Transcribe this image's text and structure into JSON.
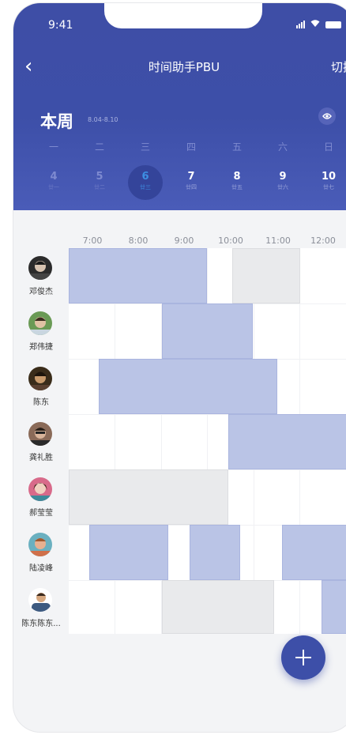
{
  "status": {
    "time": "9:41"
  },
  "header": {
    "back_label": "‹",
    "title": "时间助手PBU",
    "switch_label": "切换"
  },
  "week": {
    "title": "本周",
    "range": "8.04-8.10",
    "eye_icon": "eye-icon"
  },
  "weekdays": [
    "一",
    "二",
    "三",
    "四",
    "五",
    "六",
    "日"
  ],
  "dates": [
    {
      "num": "4",
      "lunar": "廿一",
      "state": "dim"
    },
    {
      "num": "5",
      "lunar": "廿二",
      "state": "dim"
    },
    {
      "num": "6",
      "lunar": "廿三",
      "state": "sel"
    },
    {
      "num": "7",
      "lunar": "廿四",
      "state": ""
    },
    {
      "num": "8",
      "lunar": "廿五",
      "state": ""
    },
    {
      "num": "9",
      "lunar": "廿六",
      "state": ""
    },
    {
      "num": "10",
      "lunar": "廿七",
      "state": ""
    }
  ],
  "time_slots": [
    "7:00",
    "8:00",
    "9:00",
    "10:00",
    "11:00",
    "12:00"
  ],
  "people": [
    {
      "name": "邓俊杰"
    },
    {
      "name": "郑伟捷"
    },
    {
      "name": "陈东"
    },
    {
      "name": "龚礼胜"
    },
    {
      "name": "郝莹莹"
    },
    {
      "name": "陆凌峰"
    },
    {
      "name": "陈东陈东..."
    }
  ],
  "colors": {
    "accent": "#3d4fa8",
    "busy": "#bac4e6",
    "unavailable": "#e9eaec"
  },
  "fab": {
    "icon": "plus-icon"
  }
}
